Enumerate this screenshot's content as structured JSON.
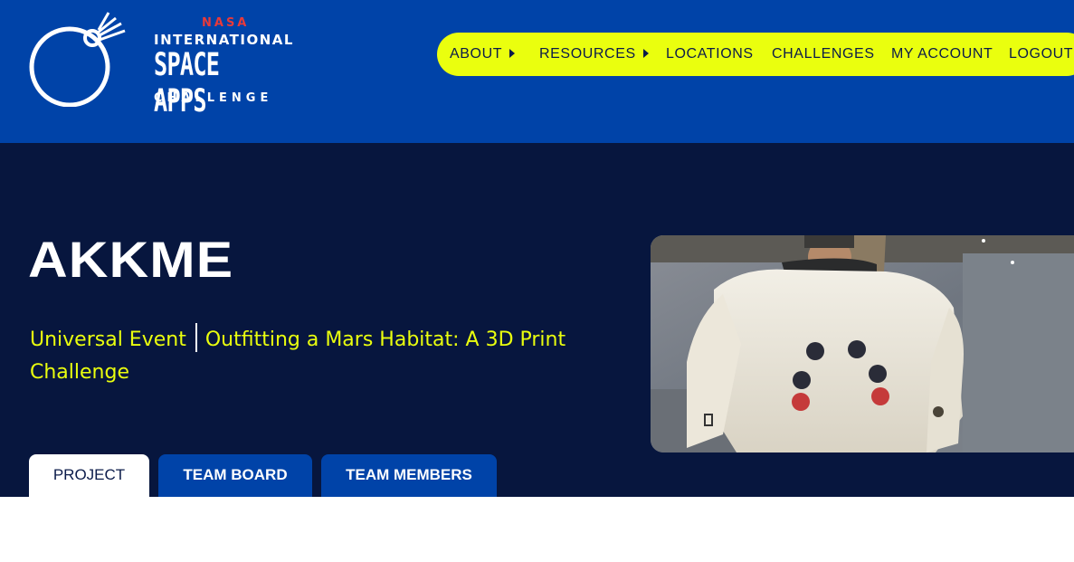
{
  "header": {
    "logo": {
      "nasa": "NASA",
      "international": "INTERNATIONAL",
      "space_apps": "SPACE APPS",
      "challenge": "CHALLENGE"
    },
    "nav": [
      {
        "label": "ABOUT",
        "has_dropdown": true
      },
      {
        "label": "RESOURCES",
        "has_dropdown": true
      },
      {
        "label": "LOCATIONS",
        "has_dropdown": false
      },
      {
        "label": "CHALLENGES",
        "has_dropdown": false
      },
      {
        "label": "MY ACCOUNT",
        "has_dropdown": false
      },
      {
        "label": "LOGOUT",
        "has_dropdown": false
      }
    ]
  },
  "project": {
    "title": "AKKME",
    "event": "Universal Event",
    "challenge": "Outfitting a Mars Habitat: A 3D Print Challenge"
  },
  "tabs": [
    {
      "label": "PROJECT",
      "active": true
    },
    {
      "label": "TEAM BOARD",
      "active": false
    },
    {
      "label": "TEAM MEMBERS",
      "active": false
    }
  ],
  "colors": {
    "header_bg": "#0043a8",
    "hero_bg": "#07163e",
    "accent_yellow": "#eaff0e",
    "nasa_red": "#e83a3a"
  }
}
